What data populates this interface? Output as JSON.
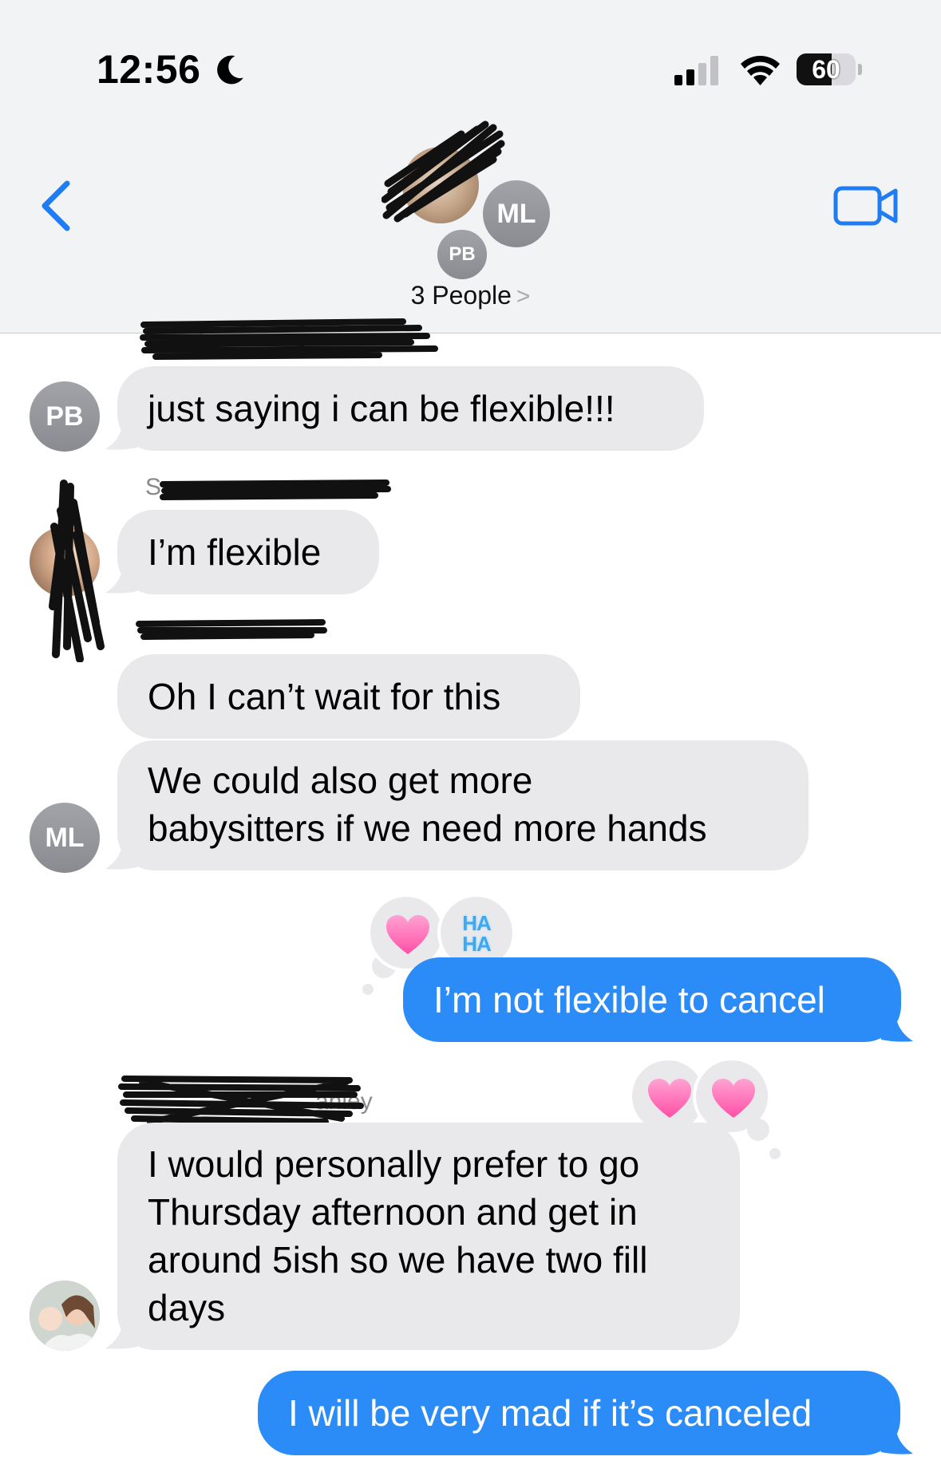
{
  "status_bar": {
    "time": "12:56",
    "battery": "60"
  },
  "header": {
    "people_label": "3 People",
    "avatars": [
      "ML",
      "PB"
    ]
  },
  "messages": [
    {
      "sender_initials": "PB",
      "text": "just saying i can be flexible!!!",
      "direction": "incoming"
    },
    {
      "sender_label": "S",
      "text": "I’m flexible",
      "direction": "incoming"
    },
    {
      "text": "Oh I can’t wait for this",
      "direction": "incoming"
    },
    {
      "sender_initials": "ML",
      "text_lines": [
        "We could also get more",
        "babysitters if we need more hands"
      ],
      "direction": "incoming"
    },
    {
      "text": "I’m not flexible to cancel",
      "direction": "outgoing",
      "tapbacks": [
        "heart",
        "haha"
      ],
      "haha_text": [
        "HA",
        "HA"
      ]
    },
    {
      "sender_label": "anley",
      "text_lines": [
        "I would personally prefer to go",
        "Thursday afternoon and get in",
        "around 5ish so we have two fill",
        "days"
      ],
      "direction": "incoming",
      "tapbacks": [
        "heart",
        "heart"
      ]
    },
    {
      "text": "I will be very mad if it’s canceled",
      "direction": "outgoing"
    }
  ],
  "colors": {
    "outgoing_bubble": "#2b8cf7",
    "incoming_bubble": "#e9e9eb",
    "accent": "#1f7cf2"
  }
}
